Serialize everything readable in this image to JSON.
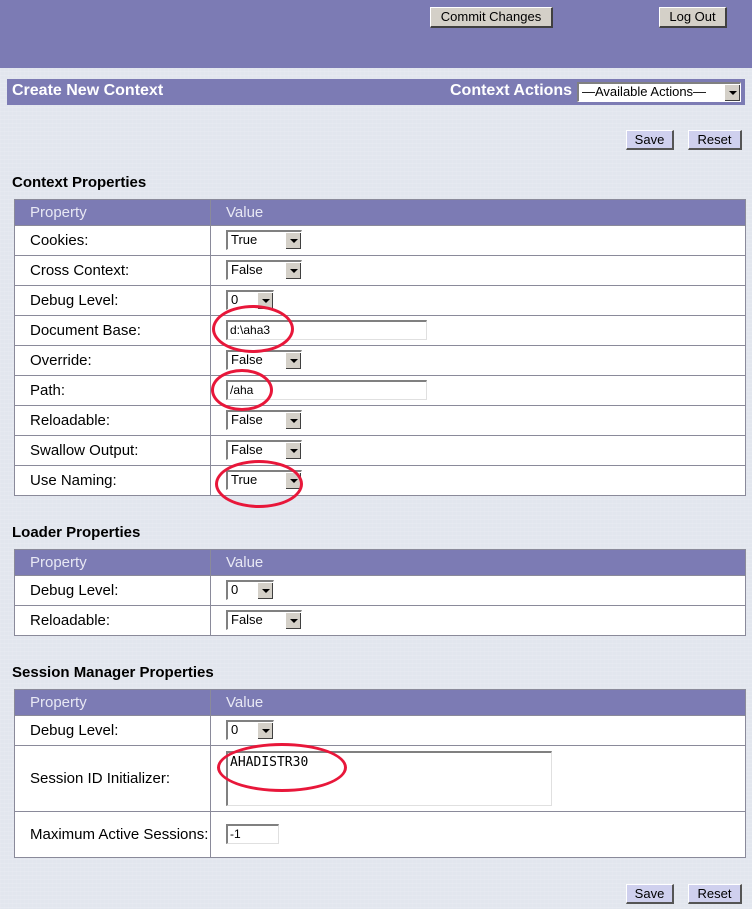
{
  "header": {
    "commit_label": "Commit Changes",
    "logout_label": "Log Out"
  },
  "titlebar": {
    "title": "Create New Context",
    "actions_label": "Context Actions",
    "actions_selected": "—Available Actions—"
  },
  "buttons": {
    "save": "Save",
    "reset": "Reset"
  },
  "context": {
    "heading": "Context Properties",
    "col_property": "Property",
    "col_value": "Value",
    "rows": [
      {
        "label": "Cookies:",
        "value": "True"
      },
      {
        "label": "Cross Context:",
        "value": "False"
      },
      {
        "label": "Debug Level:",
        "value": "0"
      },
      {
        "label": "Document Base:",
        "value": "d:\\aha3"
      },
      {
        "label": "Override:",
        "value": "False"
      },
      {
        "label": "Path:",
        "value": "/aha"
      },
      {
        "label": "Reloadable:",
        "value": "False"
      },
      {
        "label": "Swallow Output:",
        "value": "False"
      },
      {
        "label": "Use Naming:",
        "value": "True"
      }
    ]
  },
  "loader": {
    "heading": "Loader Properties",
    "col_property": "Property",
    "col_value": "Value",
    "rows": [
      {
        "label": "Debug Level:",
        "value": "0"
      },
      {
        "label": "Reloadable:",
        "value": "False"
      }
    ]
  },
  "session": {
    "heading": "Session Manager Properties",
    "col_property": "Property",
    "col_value": "Value",
    "rows": [
      {
        "label": "Debug Level:",
        "value": "0"
      },
      {
        "label": "Session ID Initializer:",
        "value": "AHADISTR30"
      },
      {
        "label": "Maximum Active Sessions:",
        "value": "-1"
      }
    ]
  },
  "colors": {
    "header_bg": "#7c7bb4",
    "annotation": "#e8173a"
  }
}
